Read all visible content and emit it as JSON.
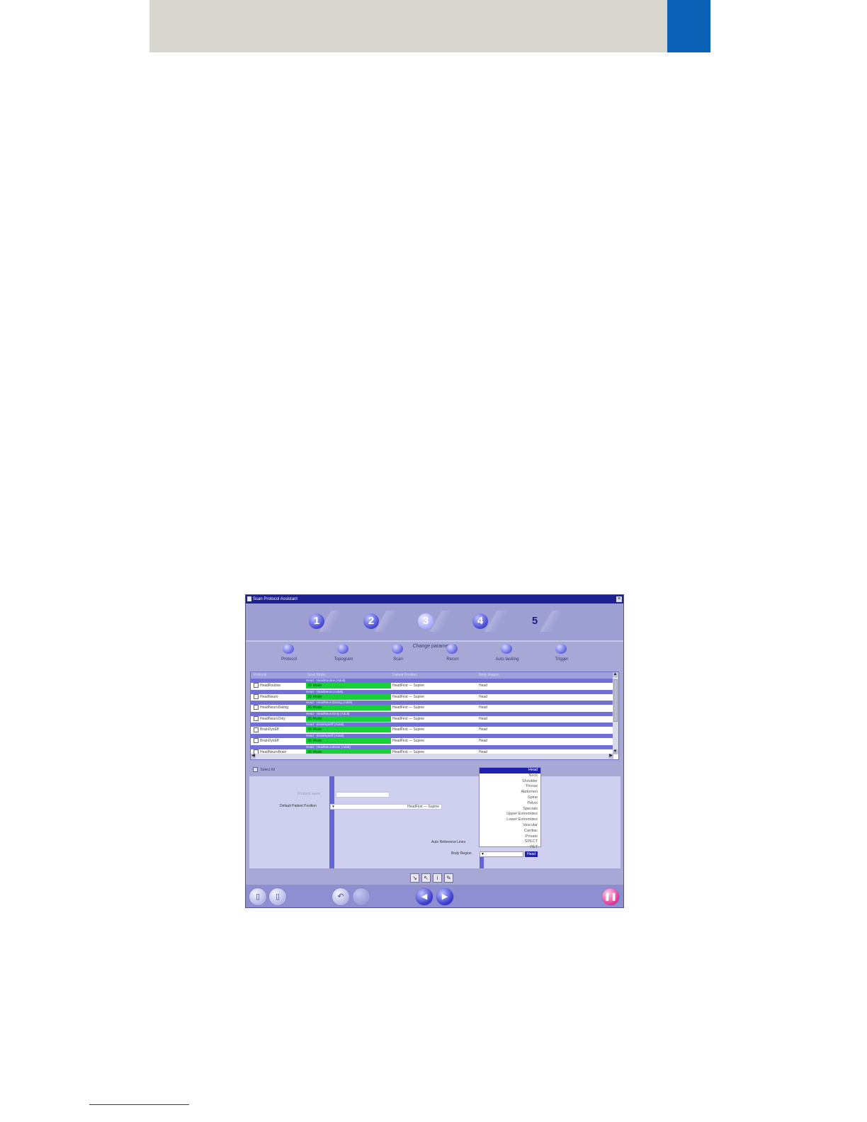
{
  "window": {
    "title": "Scan Protocol Assistant"
  },
  "steps": [
    {
      "label": "1"
    },
    {
      "label": "2"
    },
    {
      "label": "3"
    },
    {
      "label": "4"
    },
    {
      "label": "5"
    }
  ],
  "step_caption": "Change parameters",
  "tabs": [
    {
      "label": "Protocol"
    },
    {
      "label": "Topogram"
    },
    {
      "label": "Scan"
    },
    {
      "label": "Recon"
    },
    {
      "label": "Auto tasking"
    },
    {
      "label": "Trigger"
    }
  ],
  "table": {
    "columns": [
      "Protocol",
      "Scan Mode",
      "Patient Position",
      "Body Region"
    ],
    "rows": [
      {
        "group": "Head - HeadRoutine (Adult)",
        "name": "HeadRoutine",
        "mode": "3D Mode",
        "position": "HeadFirst — Supine",
        "region": "Head"
      },
      {
        "group": "Head - HeadNeuro (Adult)",
        "name": "HeadNeuro",
        "mode": "3D Mode",
        "position": "HeadFirst — Supine",
        "region": "Head"
      },
      {
        "group": "Head - HeadNeuroDating (Adult)",
        "name": "HeadNeuroDating",
        "mode": "3D Mode",
        "position": "HeadFirst — Supine",
        "region": "Head"
      },
      {
        "group": "Head - HeadNeuroOnly (Adult)",
        "name": "HeadNeuroOnly",
        "mode": "3D Mode",
        "position": "HeadFirst — Supine",
        "region": "Head"
      },
      {
        "group": "Head - BrainDynEff (Adult)",
        "name": "BrainDynEff",
        "mode": "3D Mode",
        "position": "HeadFirst — Supine",
        "region": "Head"
      },
      {
        "group": "Head - BrainDynEff (Adult)",
        "name": "BrainDynEff",
        "mode": "3D Mode",
        "position": "HeadFirst — Supine",
        "region": "Head"
      },
      {
        "group": "Head - HeadNeuroBrain (Adult)",
        "name": "HeadNeuroBrain",
        "mode": "3D Mode",
        "position": "HeadFirst — Supine",
        "region": "Head"
      }
    ]
  },
  "select_all_label": "Select All",
  "form": {
    "protocol_name_label": "Protocol name",
    "default_position_label": "Default Patient Position",
    "default_position_value": "HeadFirst — Supine",
    "auto_reference_label": "Auto Reference Lines",
    "body_region_label": "Body Region",
    "body_region_button": "Head",
    "body_regions": [
      "Head",
      "Neck",
      "Shoulder",
      "Thorax",
      "Abdomen",
      "Spine",
      "Pelvis",
      "Specials",
      "Upper Extremities",
      "Lower Extremities",
      "Vascular",
      "Cardiac",
      "Private",
      "SPECT",
      "PET"
    ],
    "selected_region": "Head"
  },
  "toolbar": {
    "icons": [
      "export-icon",
      "import-icon",
      "info-icon",
      "edit-icon"
    ]
  }
}
